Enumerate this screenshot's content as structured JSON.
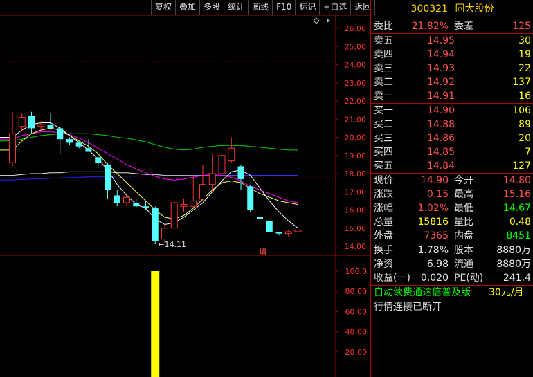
{
  "toolbar": [
    "复权",
    "叠加",
    "多股",
    "统计",
    "画线",
    "F10",
    "标记",
    "+自选",
    "返回"
  ],
  "chart_data": [
    {
      "type": "candlestick",
      "price_axis_ticks": [
        "26.00",
        "25.00",
        "24.00",
        "23.00",
        "22.00",
        "21.00",
        "20.00",
        "19.00",
        "18.00",
        "17.00",
        "16.00",
        "15.00",
        "14.00"
      ],
      "ylim": [
        13.8,
        26.4
      ],
      "candles": [
        {
          "o": 18.6,
          "h": 21.4,
          "l": 18.4,
          "c": 20.2
        },
        {
          "o": 20.6,
          "h": 21.3,
          "l": 20.3,
          "c": 21.1
        },
        {
          "o": 21.2,
          "h": 21.4,
          "l": 20.2,
          "c": 20.5
        },
        {
          "o": 20.6,
          "h": 20.9,
          "l": 20.4,
          "c": 20.7
        },
        {
          "o": 20.7,
          "h": 21.3,
          "l": 20.4,
          "c": 20.5
        },
        {
          "o": 20.5,
          "h": 20.6,
          "l": 19.1,
          "c": 19.9
        },
        {
          "o": 19.9,
          "h": 20.0,
          "l": 19.6,
          "c": 19.7
        },
        {
          "o": 19.7,
          "h": 19.8,
          "l": 19.4,
          "c": 19.5
        },
        {
          "o": 19.4,
          "h": 19.9,
          "l": 19.3,
          "c": 19.2
        },
        {
          "o": 18.9,
          "h": 19.1,
          "l": 18.3,
          "c": 18.6
        },
        {
          "o": 18.5,
          "h": 18.6,
          "l": 16.6,
          "c": 17.1
        },
        {
          "o": 16.8,
          "h": 17.1,
          "l": 16.2,
          "c": 16.4
        },
        {
          "o": 16.4,
          "h": 16.8,
          "l": 16.2,
          "c": 16.7
        },
        {
          "o": 16.4,
          "h": 16.6,
          "l": 16.1,
          "c": 16.2
        },
        {
          "o": 16.2,
          "h": 16.5,
          "l": 16.0,
          "c": 16.1
        },
        {
          "o": 16.1,
          "h": 16.2,
          "l": 14.11,
          "c": 14.3
        },
        {
          "o": 14.4,
          "h": 15.2,
          "l": 14.2,
          "c": 15.0
        },
        {
          "o": 15.0,
          "h": 16.6,
          "l": 15.0,
          "c": 16.4
        },
        {
          "o": 16.2,
          "h": 16.6,
          "l": 15.9,
          "c": 16.3
        },
        {
          "o": 16.2,
          "h": 17.8,
          "l": 16.1,
          "c": 16.5
        },
        {
          "o": 16.6,
          "h": 18.5,
          "l": 16.5,
          "c": 17.4
        },
        {
          "o": 17.4,
          "h": 19.1,
          "l": 17.0,
          "c": 18.0
        },
        {
          "o": 18.0,
          "h": 19.1,
          "l": 17.8,
          "c": 19.0
        },
        {
          "o": 18.7,
          "h": 20.0,
          "l": 18.6,
          "c": 19.4
        },
        {
          "o": 18.4,
          "h": 18.5,
          "l": 17.1,
          "c": 17.7
        },
        {
          "o": 17.3,
          "h": 17.4,
          "l": 15.9,
          "c": 16.0
        },
        {
          "o": 15.6,
          "h": 16.1,
          "l": 15.5,
          "c": 15.5
        },
        {
          "o": 15.4,
          "h": 15.4,
          "l": 14.8,
          "c": 14.8
        },
        {
          "o": 14.8,
          "h": 14.8,
          "l": 14.6,
          "c": 14.7
        },
        {
          "o": 14.7,
          "h": 14.9,
          "l": 14.5,
          "c": 14.8
        },
        {
          "o": 14.8,
          "h": 15.1,
          "l": 14.7,
          "c": 14.9
        }
      ],
      "low_marker": "←14.11",
      "annotation": "增",
      "ma_lines": [
        {
          "color": "#00d000",
          "values": [
            19.8,
            19.9,
            20.0,
            20.1,
            20.15,
            20.2,
            20.2,
            20.2,
            20.2,
            20.15,
            20.1,
            20.0,
            19.95,
            19.85,
            19.75,
            19.6,
            19.45,
            19.35,
            19.3,
            19.35,
            19.45,
            19.5,
            19.55,
            19.55,
            19.55,
            19.5,
            19.45,
            19.4,
            19.35,
            19.3,
            19.3
          ]
        },
        {
          "color": "#e0e0e0",
          "values": [
            17.9,
            17.95,
            18.0,
            18.0,
            18.05,
            18.05,
            18.1,
            18.1,
            18.1,
            18.1,
            18.1,
            18.05,
            18.05,
            18.0,
            17.95,
            17.95,
            17.9,
            17.9,
            17.9,
            17.9,
            17.9,
            17.9,
            17.9,
            17.9,
            17.9,
            17.9,
            17.9,
            17.9,
            17.9,
            17.9,
            17.9
          ]
        },
        {
          "color": "#2020ff",
          "values": [
            17.65,
            17.68,
            17.7,
            17.72,
            17.74,
            17.76,
            17.78,
            17.8,
            17.82,
            17.83,
            17.84,
            17.85,
            17.86,
            17.86,
            17.87,
            17.87,
            17.87,
            17.87,
            17.87,
            17.88,
            17.88,
            17.88,
            17.89,
            17.89,
            17.9,
            17.9,
            17.9,
            17.9,
            17.9,
            17.9,
            17.9
          ]
        },
        {
          "color": "#ff00ff",
          "values": [
            19.9,
            20.1,
            20.2,
            20.3,
            20.3,
            20.25,
            20.15,
            19.95,
            19.7,
            19.4,
            19.1,
            18.8,
            18.5,
            18.25,
            18.05,
            17.85,
            17.7,
            17.65,
            17.7,
            17.8,
            17.9,
            17.95,
            17.9,
            17.8,
            17.6,
            17.3,
            17.1,
            16.9,
            16.7,
            16.5,
            16.4
          ]
        },
        {
          "color": "#ffff60",
          "values": [
            19.3,
            19.8,
            20.2,
            20.4,
            20.5,
            20.4,
            20.1,
            19.8,
            19.5,
            19.1,
            18.5,
            18.0,
            17.5,
            17.0,
            16.5,
            16.0,
            15.6,
            15.5,
            15.7,
            16.1,
            16.6,
            17.1,
            17.5,
            17.6,
            17.5,
            17.2,
            16.9,
            16.7,
            16.5,
            16.4,
            16.3
          ]
        },
        {
          "color": "#ffffff",
          "values": [
            20.0,
            20.4,
            20.7,
            20.8,
            20.8,
            20.5,
            20.1,
            19.7,
            19.3,
            18.8,
            18.2,
            17.4,
            16.8,
            16.3,
            16.1,
            15.5,
            15.2,
            15.3,
            15.6,
            16.0,
            16.4,
            17.0,
            17.6,
            18.1,
            18.2,
            17.9,
            17.2,
            16.5,
            15.9,
            15.4,
            15.0
          ]
        }
      ]
    },
    {
      "type": "bar",
      "axis_ticks": [
        "100.0",
        "80.00",
        "60.00",
        "40.00",
        "20.00"
      ],
      "ylim": [
        0,
        105
      ],
      "bars": [
        {
          "index": 15,
          "value": 100
        }
      ]
    }
  ],
  "quote": {
    "code": "300321",
    "name": "同大股份",
    "weibi_label": "委比",
    "weibi_value": "21.82%",
    "weicha_label": "委差",
    "weicha_value": "125",
    "asks": [
      {
        "label": "卖五",
        "price": "14.95",
        "vol": "30"
      },
      {
        "label": "卖四",
        "price": "14.94",
        "vol": "19"
      },
      {
        "label": "卖三",
        "price": "14.93",
        "vol": "22"
      },
      {
        "label": "卖二",
        "price": "14.92",
        "vol": "137"
      },
      {
        "label": "卖一",
        "price": "14.91",
        "vol": "16"
      }
    ],
    "bids": [
      {
        "label": "买一",
        "price": "14.90",
        "vol": "106"
      },
      {
        "label": "买二",
        "price": "14.88",
        "vol": "89"
      },
      {
        "label": "买三",
        "price": "14.86",
        "vol": "20"
      },
      {
        "label": "买四",
        "price": "14.85",
        "vol": "7"
      },
      {
        "label": "买五",
        "price": "14.84",
        "vol": "127"
      }
    ],
    "stats": [
      {
        "l1": "现价",
        "v1": "14.90",
        "c1": "red",
        "l2": "今开",
        "v2": "14.80",
        "c2": "red"
      },
      {
        "l1": "涨跌",
        "v1": "0.15",
        "c1": "red",
        "l2": "最高",
        "v2": "15.16",
        "c2": "red"
      },
      {
        "l1": "涨幅",
        "v1": "1.02%",
        "c1": "red",
        "l2": "最低",
        "v2": "14.67",
        "c2": "green"
      },
      {
        "l1": "总量",
        "v1": "15816",
        "c1": "yellow",
        "l2": "量比",
        "v2": "0.48",
        "c2": "yellow"
      },
      {
        "l1": "外盘",
        "v1": "7365",
        "c1": "red",
        "l2": "内盘",
        "v2": "8451",
        "c2": "green"
      }
    ],
    "fundamentals": [
      {
        "l1": "换手",
        "v1": "1.78%",
        "l2": "股本",
        "v2": "8880万"
      },
      {
        "l1": "净资",
        "v1": "6.98",
        "l2": "流通",
        "v2": "8880万"
      },
      {
        "l1": "收益(一)",
        "v1": "0.020",
        "l2": "PE(动)",
        "v2": "241.4"
      }
    ],
    "ad_text": "自动续费通达信普及版",
    "ad_price": "30元/月",
    "status": "行情连接已断开"
  },
  "colors": {
    "up": "#ff3232",
    "down": "#54ffff",
    "grid": "#b00000",
    "axis_text": "#ff3232"
  }
}
